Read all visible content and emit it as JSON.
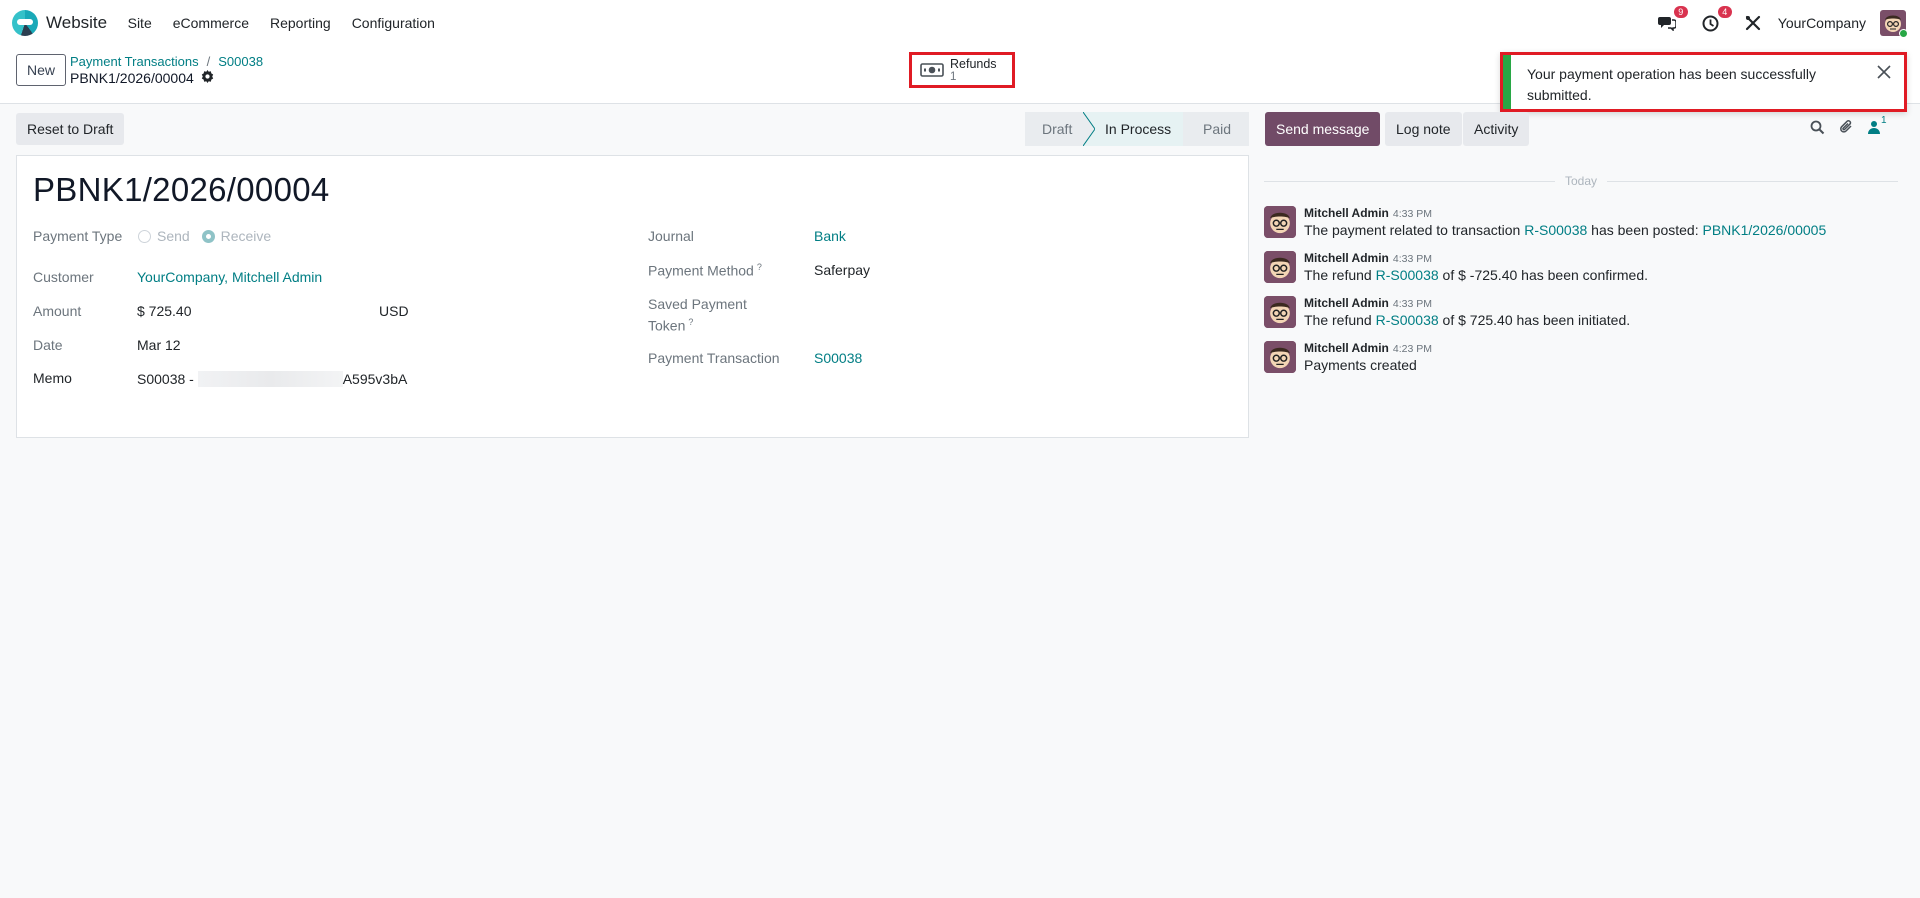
{
  "navbar": {
    "app_name": "Website",
    "menu": [
      "Site",
      "eCommerce",
      "Reporting",
      "Configuration"
    ],
    "messages_count": "9",
    "activities_count": "4",
    "company": "YourCompany"
  },
  "control_panel": {
    "new_label": "New",
    "breadcrumb": [
      "Payment Transactions",
      "S00038"
    ],
    "record_name": "PBNK1/2026/00004",
    "smart_button": {
      "label": "Refunds",
      "value": "1"
    }
  },
  "toast": {
    "message": "Your payment operation has been successfully submitted."
  },
  "form": {
    "reset_label": "Reset to Draft",
    "stages": [
      "Draft",
      "In Process",
      "Paid"
    ],
    "current_stage": "In Process",
    "title": "PBNK1/2026/00004",
    "left": {
      "payment_type_label": "Payment Type",
      "payment_type_options": [
        "Send",
        "Receive"
      ],
      "payment_type_selected": "Receive",
      "customer_label": "Customer",
      "customer_value": "YourCompany, Mitchell Admin",
      "amount_label": "Amount",
      "amount_value": "$ 725.40",
      "currency_value": "USD",
      "date_label": "Date",
      "date_value": "Mar 12",
      "memo_label": "Memo",
      "memo_prefix": "S00038 -",
      "memo_suffix": "A595v3bA"
    },
    "right": {
      "journal_label": "Journal",
      "journal_value": "Bank",
      "method_label": "Payment Method",
      "method_value": "Saferpay",
      "token_label_1": "Saved Payment",
      "token_label_2": "Token",
      "transaction_label": "Payment Transaction",
      "transaction_value": "S00038",
      "help_mark": "?"
    }
  },
  "chatter": {
    "send_message": "Send message",
    "log_note": "Log note",
    "activity": "Activity",
    "followers_count": "1",
    "date_separator": "Today",
    "messages": [
      {
        "author": "Mitchell Admin",
        "time": "4:33 PM",
        "text_1": "The payment related to transaction ",
        "link_1": "R-S00038",
        "text_2": " has been posted: ",
        "link_2": "PBNK1/2026/00005"
      },
      {
        "author": "Mitchell Admin",
        "time": "4:33 PM",
        "text_1": "The refund ",
        "link_1": "R-S00038",
        "text_2": " of $ -725.40 has been confirmed."
      },
      {
        "author": "Mitchell Admin",
        "time": "4:33 PM",
        "text_1": "The refund ",
        "link_1": "R-S00038",
        "text_2": " of $ 725.40 has been initiated."
      },
      {
        "author": "Mitchell Admin",
        "time": "4:23 PM",
        "text_1": "Payments created"
      }
    ]
  },
  "colors": {
    "accent": "#017e84",
    "primary": "#714b67",
    "success": "#28a745",
    "highlight_border": "#e01b24"
  }
}
